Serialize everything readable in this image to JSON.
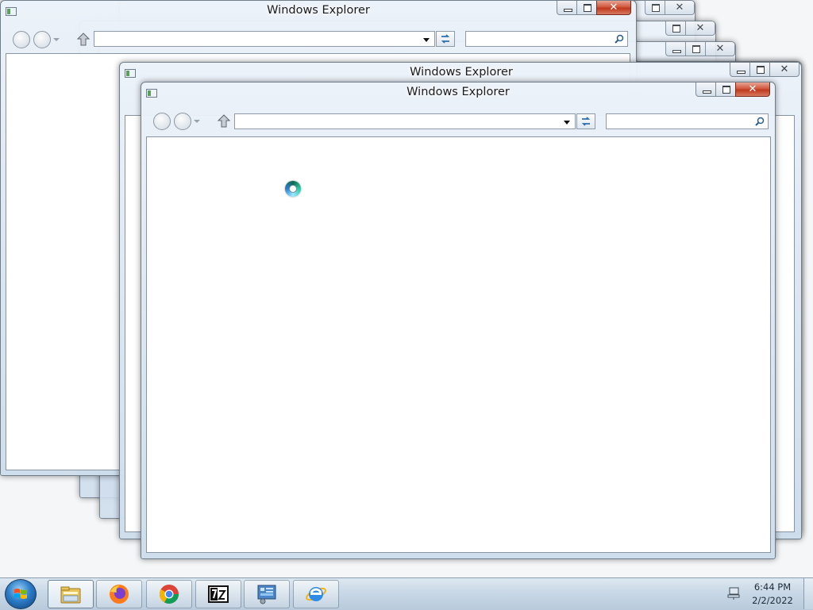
{
  "windows": [
    {
      "title": "Windows Explorer",
      "role": "back"
    },
    {
      "title": "Windows Explorer",
      "role": "middle"
    },
    {
      "title": "Windows Explorer",
      "role": "front"
    }
  ],
  "toolbar": {
    "back_icon": "back-arrow-icon",
    "forward_icon": "forward-arrow-icon",
    "up_icon": "up-arrow-icon",
    "address_value": "",
    "search_value": "",
    "search_icon": "magnifier-icon",
    "refresh_icon": "refresh-icon"
  },
  "cursor": {
    "state": "busy",
    "icon": "busy-spinner-icon"
  },
  "taskbar": {
    "start_icon": "windows-orb-icon",
    "pinned": [
      {
        "name": "windows-explorer",
        "icon": "folder-icon",
        "active": true
      },
      {
        "name": "firefox",
        "icon": "firefox-icon",
        "active": false
      },
      {
        "name": "chrome",
        "icon": "chrome-icon",
        "active": false
      },
      {
        "name": "7-zip",
        "icon": "7zip-icon",
        "active": false
      },
      {
        "name": "control-panel",
        "icon": "control-panel-icon",
        "active": false
      },
      {
        "name": "internet-explorer",
        "icon": "ie-icon",
        "active": false
      }
    ],
    "tray_icon": "network-icon",
    "time": "6:44 PM",
    "date": "2/2/2022"
  },
  "colors": {
    "close_button": "#c8442a",
    "window_frame": "#d8e4f1",
    "taskbar": "#c9d8e6"
  }
}
